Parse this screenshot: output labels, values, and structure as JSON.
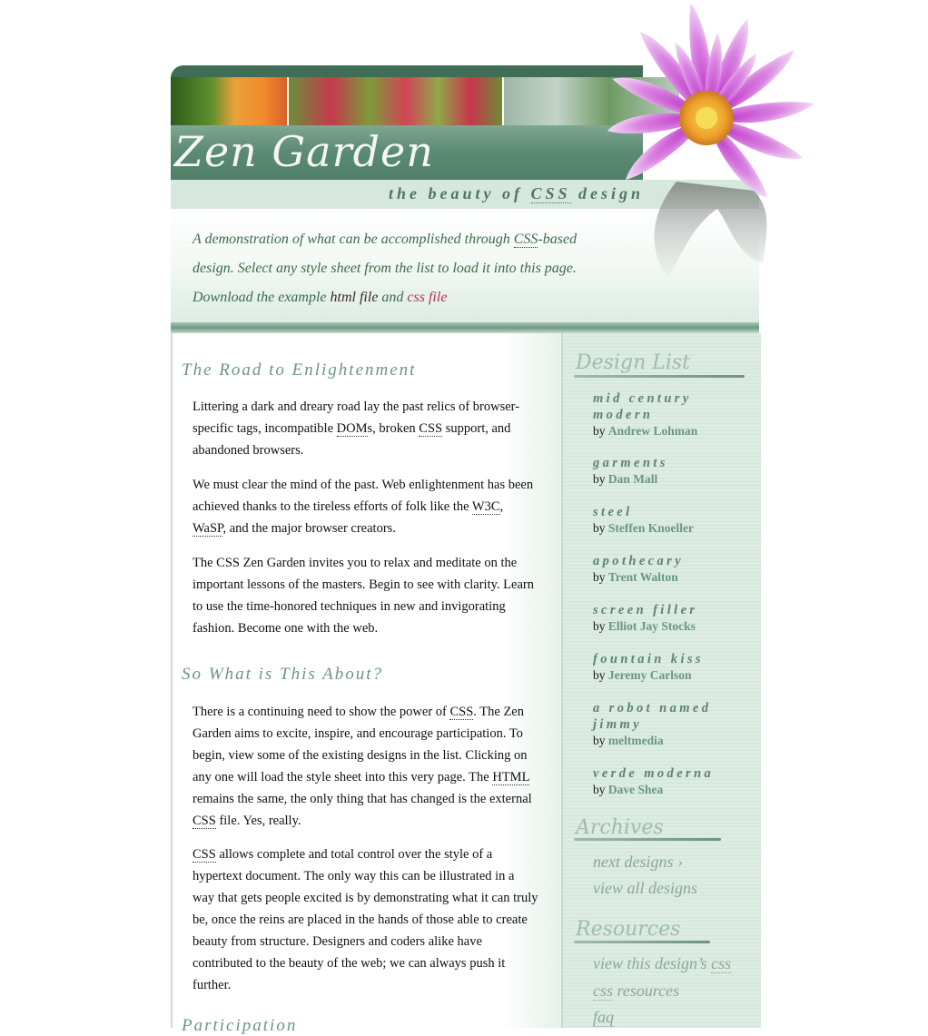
{
  "header": {
    "logo_text": "Zen Garden",
    "tagline_pre": "the beauty of ",
    "tagline_abbr": "CSS",
    "tagline_post": " design"
  },
  "intro": {
    "line1_pre": "A demonstration of what can be accomplished through ",
    "line1_abbr": "CSS",
    "line1_post": "-based design. Select any style sheet from the list to load it into this page.",
    "download_pre": "Download the example ",
    "html_link": "html file",
    "and_text": " and ",
    "css_link": "css file"
  },
  "main": {
    "sections": [
      {
        "title": "The Road to Enlightenment",
        "paragraphs": [
          {
            "p1": "Littering a dark and dreary road lay the past relics of browser-specific tags, incompatible ",
            "abbr1": "DOM",
            "p2": "s, broken ",
            "abbr2": "CSS",
            "p3": " support, and abandoned browsers."
          },
          {
            "p1": "We must clear the mind of the past. Web enlightenment has been achieved thanks to the tireless efforts of folk like the ",
            "abbr1": "W3C",
            "p2": ", ",
            "abbr2": "WaSP",
            "p3": ", and the major browser creators."
          },
          {
            "text": "The CSS Zen Garden invites you to relax and meditate on the important lessons of the masters. Begin to see with clarity. Learn to use the time-honored techniques in new and invigorating fashion. Become one with the web."
          }
        ]
      },
      {
        "title": "So What is This About?",
        "paragraphs": [
          {
            "p1": "There is a continuing need to show the power of ",
            "abbr1": "CSS",
            "p2": ". The Zen Garden aims to excite, inspire, and encourage participation. To begin, view some of the existing designs in the list. Clicking on any one will load the style sheet into this very page. The ",
            "abbr2": "HTML",
            "p3": " remains the same, the only thing that has changed is the external ",
            "abbr3": "CSS",
            "p4": " file. Yes, really."
          },
          {
            "abbr1": "CSS",
            "p1": " allows complete and total control over the style of a hypertext document. The only way this can be illustrated in a way that gets people excited is by demonstrating what it can truly be, once the reins are placed in the hands of those able to create beauty from structure. Designers and coders alike have contributed to the beauty of the web; we can always push it further."
          }
        ]
      },
      {
        "title": "Participation"
      }
    ]
  },
  "sidebar": {
    "design_list_heading": "Design List",
    "by_label": "by ",
    "designs": [
      {
        "name": "mid century modern",
        "author": "Andrew Lohman"
      },
      {
        "name": "garments",
        "author": "Dan Mall"
      },
      {
        "name": "steel",
        "author": "Steffen Knoeller"
      },
      {
        "name": "apothecary",
        "author": "Trent Walton"
      },
      {
        "name": "screen filler",
        "author": "Elliot Jay Stocks"
      },
      {
        "name": "fountain kiss",
        "author": "Jeremy Carlson"
      },
      {
        "name": "a robot named jimmy",
        "author": "meltmedia"
      },
      {
        "name": "verde moderna",
        "author": "Dave Shea"
      }
    ],
    "archives_heading": "Archives",
    "archives_links": [
      "next designs ›",
      "view all designs"
    ],
    "resources_heading": "Resources",
    "resources": {
      "view_css_pre": "view this design’s ",
      "view_css_abbr": "css",
      "css_res_abbr": "css",
      "css_res_post": " resources",
      "faq": "faq"
    }
  },
  "colors": {
    "accent_green": "#6b9682",
    "link_pink": "#b5325a",
    "sidebar_bg": "#dcece2"
  }
}
